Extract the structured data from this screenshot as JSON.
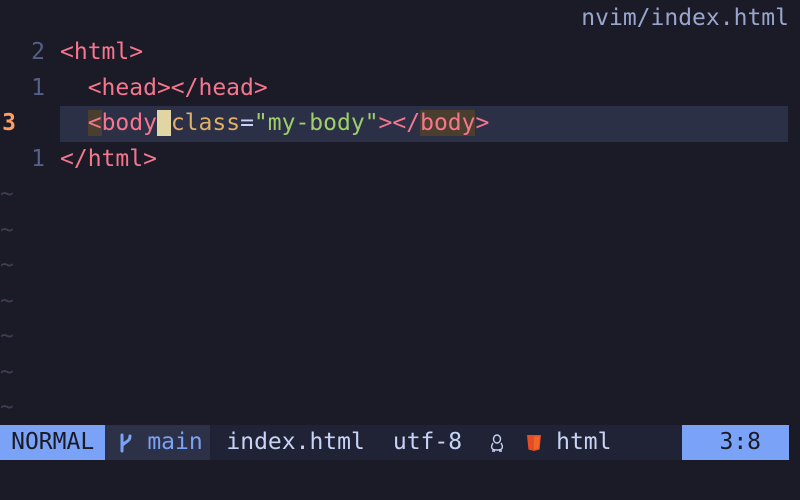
{
  "window": {
    "title": "nvim/index.html"
  },
  "editor": {
    "lines": [
      {
        "number": "2",
        "current": false,
        "indent": "",
        "parts": [
          {
            "cls": "tag",
            "text": "<html>"
          }
        ]
      },
      {
        "number": "1",
        "current": false,
        "indent": "  ",
        "parts": [
          {
            "cls": "tag",
            "text": "<head></head>"
          }
        ]
      },
      {
        "number": "3",
        "current": true,
        "indent": "  ",
        "parts": [
          {
            "cls": "tag match",
            "text": "<"
          },
          {
            "cls": "tag",
            "text": "body"
          },
          {
            "cls": "cursor",
            "text": " "
          },
          {
            "cls": "attr",
            "text": "class"
          },
          {
            "cls": "plain",
            "text": "="
          },
          {
            "cls": "str",
            "text": "\"my-body\""
          },
          {
            "cls": "tag",
            "text": "></"
          },
          {
            "cls": "tag match",
            "text": "body"
          },
          {
            "cls": "tag",
            "text": ">"
          }
        ]
      },
      {
        "number": "1",
        "current": false,
        "indent": "",
        "parts": [
          {
            "cls": "tag",
            "text": "</html>"
          }
        ]
      }
    ],
    "filler": "~",
    "filler_count": 7
  },
  "statusline": {
    "mode": "NORMAL",
    "branch_icon": "git-branch-icon",
    "branch": "main",
    "filename": "index.html",
    "encoding": "utf-8",
    "os_icon": "linux-penguin-icon",
    "filetype_icon": "html5-icon",
    "filetype": "html",
    "position": "3:8"
  },
  "colors": {
    "background": "#1a1b26",
    "mode_accent": "#7aa2f7",
    "tag": "#f7768e",
    "attribute": "#e0af68",
    "string": "#9ece6a",
    "current_line_number": "#ff9e64"
  }
}
